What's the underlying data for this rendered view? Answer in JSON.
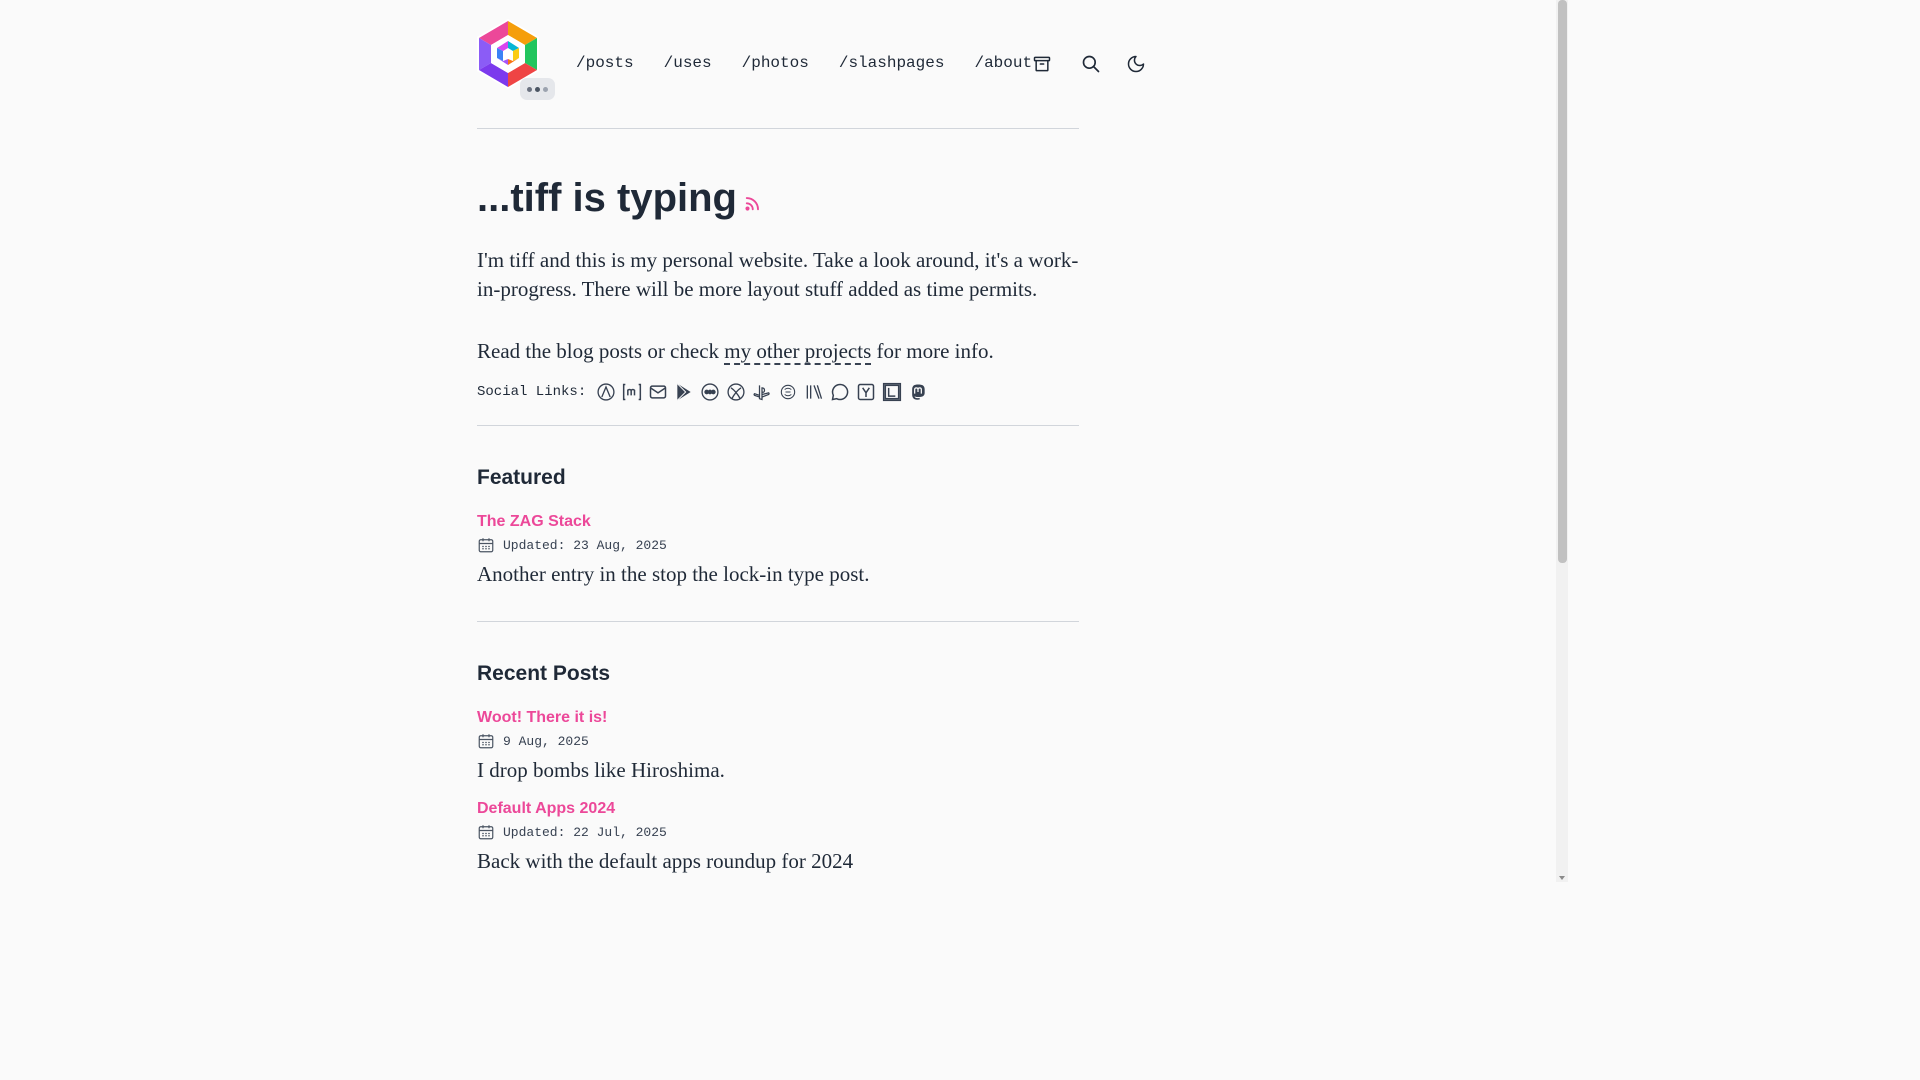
{
  "header": {
    "nav": [
      "/posts",
      "/uses",
      "/photos",
      "/slashpages",
      "/about"
    ],
    "icons": [
      "archive-icon",
      "search-icon",
      "moon-icon"
    ]
  },
  "hero": {
    "title": "...tiff is typing",
    "intro": "I'm tiff and this is my personal website. Take a look around, it's a work-in-progress. There will be more layout stuff added as time permits.",
    "line2_before": "Read the blog posts or check ",
    "line2_link": "my other projects",
    "line2_after": " for more info."
  },
  "social": {
    "label": "Social Links:",
    "icons": [
      "arch-icon",
      "matrix-icon",
      "mail-icon",
      "google-play-icon",
      "letterboxd-icon",
      "xbox-icon",
      "playstation-icon",
      "goodreads-icon",
      "library-icon",
      "chat-icon",
      "ycombinator-icon",
      "lastfm-icon",
      "mastodon-icon"
    ]
  },
  "featured": {
    "heading": "Featured",
    "posts": [
      {
        "title": "The ZAG Stack",
        "date": "Updated: 23 Aug, 2025",
        "desc": "Another entry in the stop the lock-in type post."
      }
    ]
  },
  "recent": {
    "heading": "Recent Posts",
    "posts": [
      {
        "title": "Woot! There it is!",
        "date": "9 Aug, 2025",
        "desc": "I drop bombs like Hiroshima."
      },
      {
        "title": "Default Apps 2024",
        "date": "Updated: 22 Jul, 2025",
        "desc": "Back with the default apps roundup for 2024"
      }
    ]
  },
  "colors": {
    "accent": "#ec4899",
    "text": "#1f2937",
    "background": "#fafafa"
  }
}
